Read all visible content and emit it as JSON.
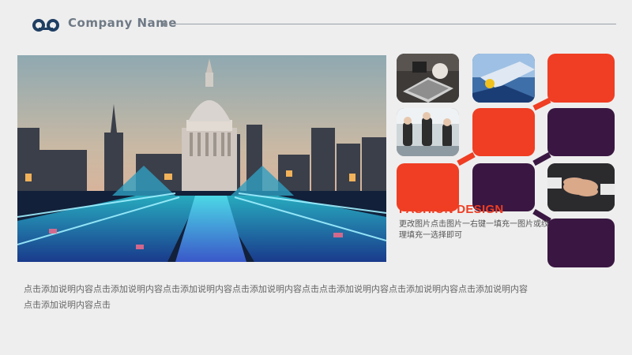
{
  "header": {
    "company_name": "Company Name"
  },
  "feature": {
    "title": "FASHION DESIGN",
    "description": "更改图片点击图片一右键一填充一图片或纹理填充一选择即可"
  },
  "caption": "点击添加说明内容点击添加说明内容点击添加说明内容点击添加说明内容点击点击添加说明内容点击添加说明内容点击添加说明内容点击添加说明内容点击",
  "colors": {
    "accent": "#ef3e23",
    "dark": "#3a1742",
    "background": "#eeeeee"
  }
}
